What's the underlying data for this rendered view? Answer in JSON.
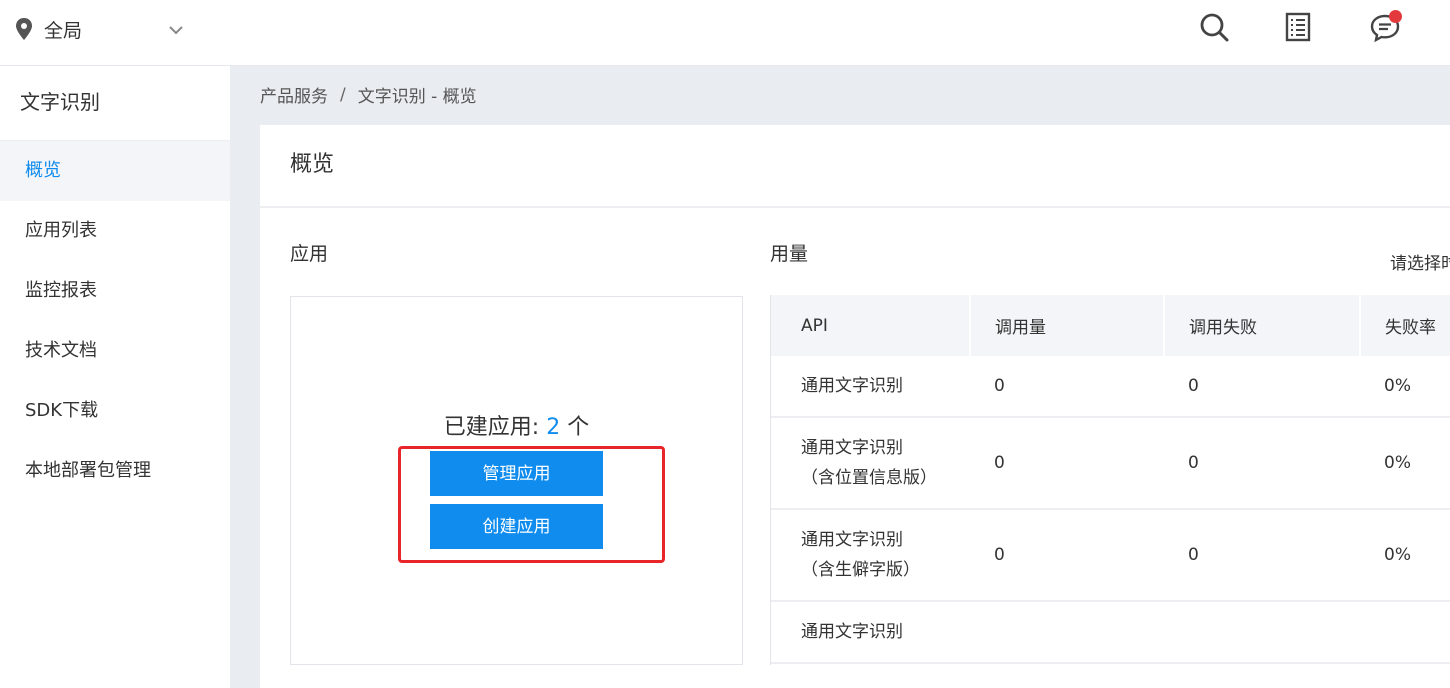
{
  "topbar": {
    "region_label": "全局",
    "icons": [
      "search-icon",
      "document-list-icon",
      "message-icon"
    ],
    "notification_color": "#e4393c"
  },
  "sidebar": {
    "title": "文字识别",
    "items": [
      {
        "label": "概览",
        "active": true
      },
      {
        "label": "应用列表"
      },
      {
        "label": "监控报表"
      },
      {
        "label": "技术文档"
      },
      {
        "label": "SDK下载"
      },
      {
        "label": "本地部署包管理"
      }
    ]
  },
  "breadcrumb": {
    "parent": "产品服务",
    "separator": "/",
    "current": "文字识别 - 概览"
  },
  "overview": {
    "title": "概览",
    "app_section": {
      "title": "应用",
      "built_label": "已建应用:",
      "built_count": "2",
      "built_unit": "个",
      "manage_button": "管理应用",
      "create_button": "创建应用"
    },
    "usage_section": {
      "title": "用量",
      "date_hint": "请选择时",
      "columns": [
        "API",
        "调用量",
        "调用失败",
        "失败率"
      ],
      "rows": [
        {
          "api": "通用文字识别",
          "calls": "0",
          "failed": "0",
          "rate": "0%"
        },
        {
          "api": "通用文字识别（含位置信息版）",
          "calls": "0",
          "failed": "0",
          "rate": "0%"
        },
        {
          "api": "通用文字识别（含生僻字版）",
          "calls": "0",
          "failed": "0",
          "rate": "0%"
        },
        {
          "api": "通用文字识别",
          "calls": "",
          "failed": "",
          "rate": ""
        }
      ]
    }
  },
  "colors": {
    "accent": "#108cee",
    "highlight_border": "#e8262a",
    "page_bg": "#e9ecf0"
  }
}
